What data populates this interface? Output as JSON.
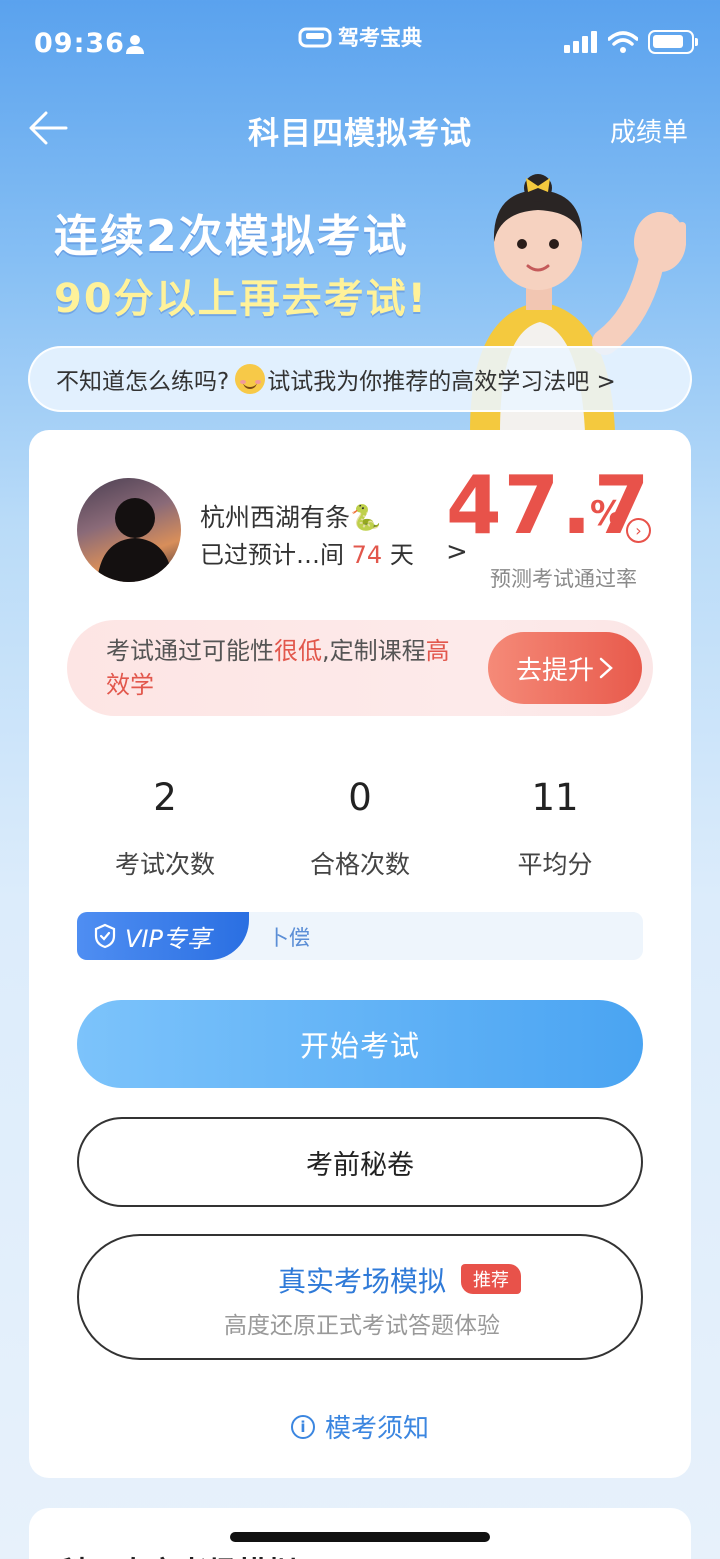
{
  "status_bar": {
    "time": "09:36",
    "app_name": "驾考宝典"
  },
  "nav": {
    "title": "科目四模拟考试",
    "right_link": "成绩单"
  },
  "banner": {
    "line1": "连续2次模拟考试",
    "line2": "90分以上再去考试!"
  },
  "tip": {
    "text_before": "不知道怎么练吗?",
    "text_after": "试试我为你推荐的高效学习法吧 >"
  },
  "profile": {
    "name": "杭州西湖有条🐍",
    "pass_prefix": "已过预计…间",
    "days": "74",
    "days_unit": "天",
    "chevron": ">"
  },
  "pass_rate": {
    "value": "47.7",
    "unit": "%",
    "label": "预测考试通过率"
  },
  "alert": {
    "text_1": "考试通过可能性",
    "text_red_1": "很低",
    "text_2": ",定制课程",
    "text_red_2": "高效学",
    "button": "去提升"
  },
  "stats": [
    {
      "value": "2",
      "label": "考试次数"
    },
    {
      "value": "0",
      "label": "合格次数"
    },
    {
      "value": "11",
      "label": "平均分"
    }
  ],
  "vip": {
    "tag": "VIP专享",
    "text": "卜偿"
  },
  "buttons": {
    "start": "开始考试",
    "secret": "考前秘卷",
    "real_title": "真实考场模拟",
    "real_badge": "推荐",
    "real_sub": "高度还原正式考试答题体验"
  },
  "notice": "模考须知",
  "section2_title": "科四真实考场模拟",
  "colors": {
    "accent_red": "#e8524a",
    "accent_blue": "#4aa4f2",
    "link_blue": "#3b86e0"
  }
}
